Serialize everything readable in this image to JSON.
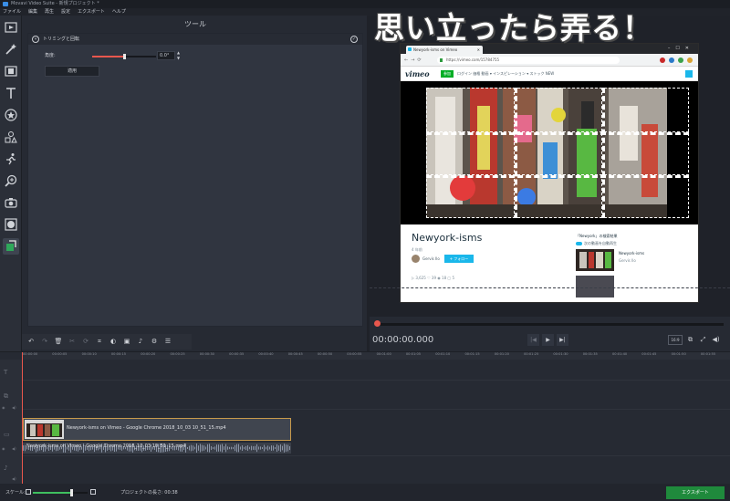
{
  "window": {
    "title": "Movavi Video Suite - 新規プロジェクト *"
  },
  "menu": [
    "ファイル",
    "編集",
    "再生",
    "設定",
    "エクスポート",
    "ヘルプ"
  ],
  "tools": [
    "media-icon",
    "magic-wand-icon",
    "filmstrip-icon",
    "title-text-icon",
    "sticker-icon",
    "shapes-icon",
    "motion-icon",
    "zoom-icon",
    "camera-icon",
    "vignette-icon",
    "crop-rotate-icon"
  ],
  "panel": {
    "title": "ツール",
    "section": "トリミングと回転",
    "angle_label": "角度:",
    "angle_value": "0.0°",
    "apply_label": "適用"
  },
  "preview": {
    "browser": {
      "tab_title": "Newyork-isms on Vimeo",
      "url": "https://vimeo.com/15784755"
    },
    "page": {
      "logo": "vimeo",
      "join": "参加",
      "links": "ログイン  価格  動画 ▾  インスピレーション ▾  ストック  NEW",
      "video_title": "Newyork-isms",
      "video_sub": "4 年前",
      "author": "Gervis Ilo",
      "follow": "+ フォロー",
      "stats": "▷ 3,625   ♡ 39   ◉ 18   ▢ 5",
      "side_head": "「Newyork」の検索結果",
      "autoplay": "次の動画を自動再生",
      "side_title": "Newyork-isms",
      "side_author": "Gervis Ilo"
    }
  },
  "player": {
    "timecode": "00:00:00.000",
    "ratio": "16:9",
    "progress": 0
  },
  "timeline": {
    "ticks": [
      "00:00:00",
      "00:00:05",
      "00:00:10",
      "00:00:15",
      "00:00:20",
      "00:00:25",
      "00:00:30",
      "00:00:35",
      "00:00:40",
      "00:00:45",
      "00:00:50",
      "00:00:55",
      "00:01:00",
      "00:01:05",
      "00:01:10",
      "00:01:15",
      "00:01:20",
      "00:01:25",
      "00:01:30",
      "00:01:35",
      "00:01:40",
      "00:01:45",
      "00:01:50",
      "00:01:55"
    ],
    "clip_video": "Newyork-isms on Vimeo - Google Chrome 2018_10_03 10_51_15.mp4",
    "clip_audio": "Newyork-isms on Vimeo - Google Chrome 2018_10_03 10_51_15.mp4"
  },
  "bottom": {
    "scale_label": "スケール:",
    "duration": "プロジェクトの長さ: 00:38",
    "export": "エクスポート",
    "zoom_level": 0.7
  },
  "caption": "思い立ったら弄る！",
  "colors": {
    "accent": "#e8574d",
    "export": "#1f8a3c",
    "clip_border": "#c79a4c",
    "vimeo_blue": "#1ab7ea"
  }
}
